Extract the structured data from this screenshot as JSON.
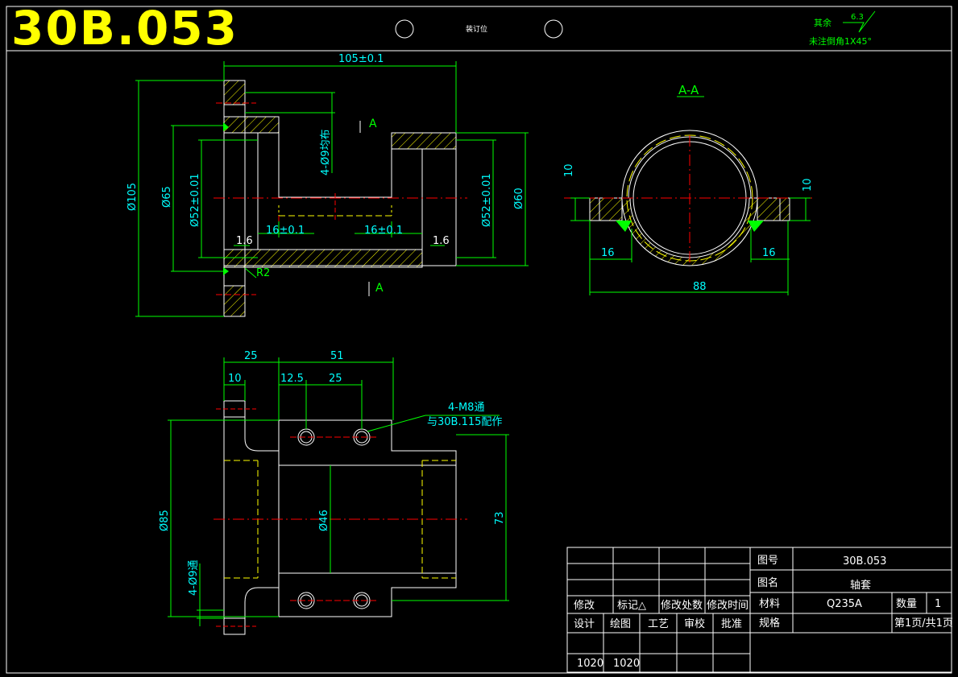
{
  "header": {
    "drawing_code": "30B.053",
    "binding_label": "装订位",
    "roughness_label": "其余",
    "roughness_value": "6.3",
    "chamfer_note": "未注倒角1X45°"
  },
  "front_view": {
    "dim_length": "105±0.1",
    "dim_outer_dia": "Ø105",
    "dim_flange_dia": "Ø65",
    "dim_bore_left": "Ø52±0.01",
    "dim_bore_right": "Ø52±0.01",
    "dim_outer_right": "Ø60",
    "dim_holes": "4-Ø9均布",
    "dim_groove_left": "16±0.1",
    "dim_groove_right": "16±0.1",
    "roughness_left": "1.6",
    "roughness_right": "1.6",
    "radius": "R2",
    "section_mark_top": "A",
    "section_mark_bottom": "A"
  },
  "section_view": {
    "title": "A-A",
    "dim_left_height": "10",
    "dim_right_height": "10",
    "dim_left_width": "16",
    "dim_right_width": "16",
    "dim_total_width": "88"
  },
  "bottom_view": {
    "dim_25": "25",
    "dim_51": "51",
    "dim_10": "10",
    "dim_12_5": "12.5",
    "dim_25b": "25",
    "callout_line1": "4-M8通",
    "callout_line2": "与30B.115配作",
    "dim_85": "Ø85",
    "dim_46": "Ø46",
    "dim_73": "73",
    "dim_holes": "4-Ø9通"
  },
  "title_block": {
    "label_drawing_no": "图号",
    "drawing_no": "30B.053",
    "label_name": "图名",
    "part_name": "轴套",
    "label_material": "材料",
    "material": "Q235A",
    "label_quantity": "数量",
    "quantity": "1",
    "label_spec": "规格",
    "page_info": "第1页/共1页",
    "label_modify": "修改",
    "label_mark": "标记△",
    "label_modify_count": "修改处数",
    "label_modify_time": "修改时间",
    "label_design": "设计",
    "label_drawing": "绘图",
    "label_process": "工艺",
    "label_review": "审校",
    "label_approve": "批准",
    "design_code": "1020",
    "drawing_code": "1020"
  }
}
